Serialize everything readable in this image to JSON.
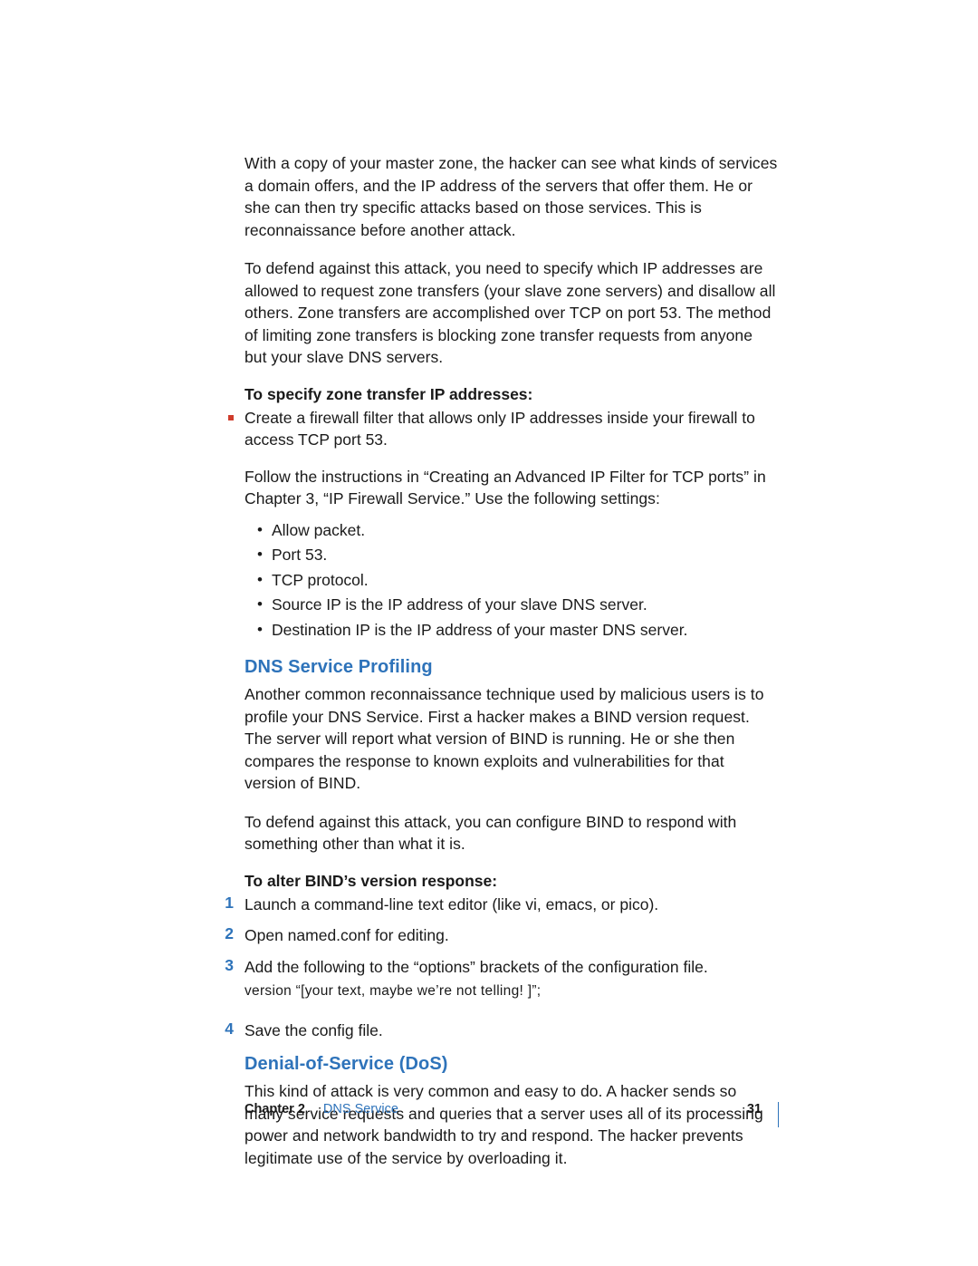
{
  "paragraphs": {
    "intro1": "With a copy of your master zone, the hacker can see what kinds of services a domain offers, and the IP address of the servers that offer them. He or she can then try specific attacks based on those services. This is reconnaissance before another attack.",
    "intro2": "To defend against this attack, you need to specify which IP addresses are allowed to request zone transfers (your slave zone servers) and disallow all others. Zone transfers are accomplished over TCP on port 53. The method of limiting zone transfers is blocking zone transfer requests from anyone but your slave DNS servers.",
    "subhead1": "To specify zone transfer IP addresses:",
    "bullet1": "Create a firewall filter that allows only IP addresses inside your firewall to access TCP port 53.",
    "follow": "Follow the instructions in “Creating an Advanced IP Filter for TCP ports” in Chapter 3, “IP Firewall Service.” Use the following settings:",
    "settings": [
      "Allow packet.",
      "Port 53.",
      "TCP protocol.",
      "Source IP is the IP address of your slave DNS server.",
      "Destination IP is the IP address of your master DNS server."
    ],
    "h3a": "DNS Service Profiling",
    "profiling1": "Another common reconnaissance technique used by malicious users is to profile your DNS Service. First a hacker makes a BIND version request. The server will report what version of BIND is running. He or she then compares the response to known exploits and vulnerabilities for that version of BIND.",
    "profiling2": "To defend against this attack, you can configure BIND to respond with something other than what it is.",
    "subhead2": "To alter BIND’s version response:",
    "steps": [
      "Launch a command-line text editor (like vi, emacs, or pico).",
      "Open named.conf for editing.",
      "Add the following to the “options” brackets of the configuration file.",
      "Save the config file."
    ],
    "code": "version    “[your text, maybe  we’re not telling! ]”;",
    "h3b": "Denial-of-Service (DoS)",
    "dos1": "This kind of attack is very common and easy to do. A hacker sends so many service requests and queries that a server uses all of its processing power and network bandwidth to try and respond. The hacker prevents legitimate use of the service by overloading it."
  },
  "footer": {
    "chapter_label": "Chapter 2",
    "chapter_name": "DNS Service",
    "page": "31"
  }
}
